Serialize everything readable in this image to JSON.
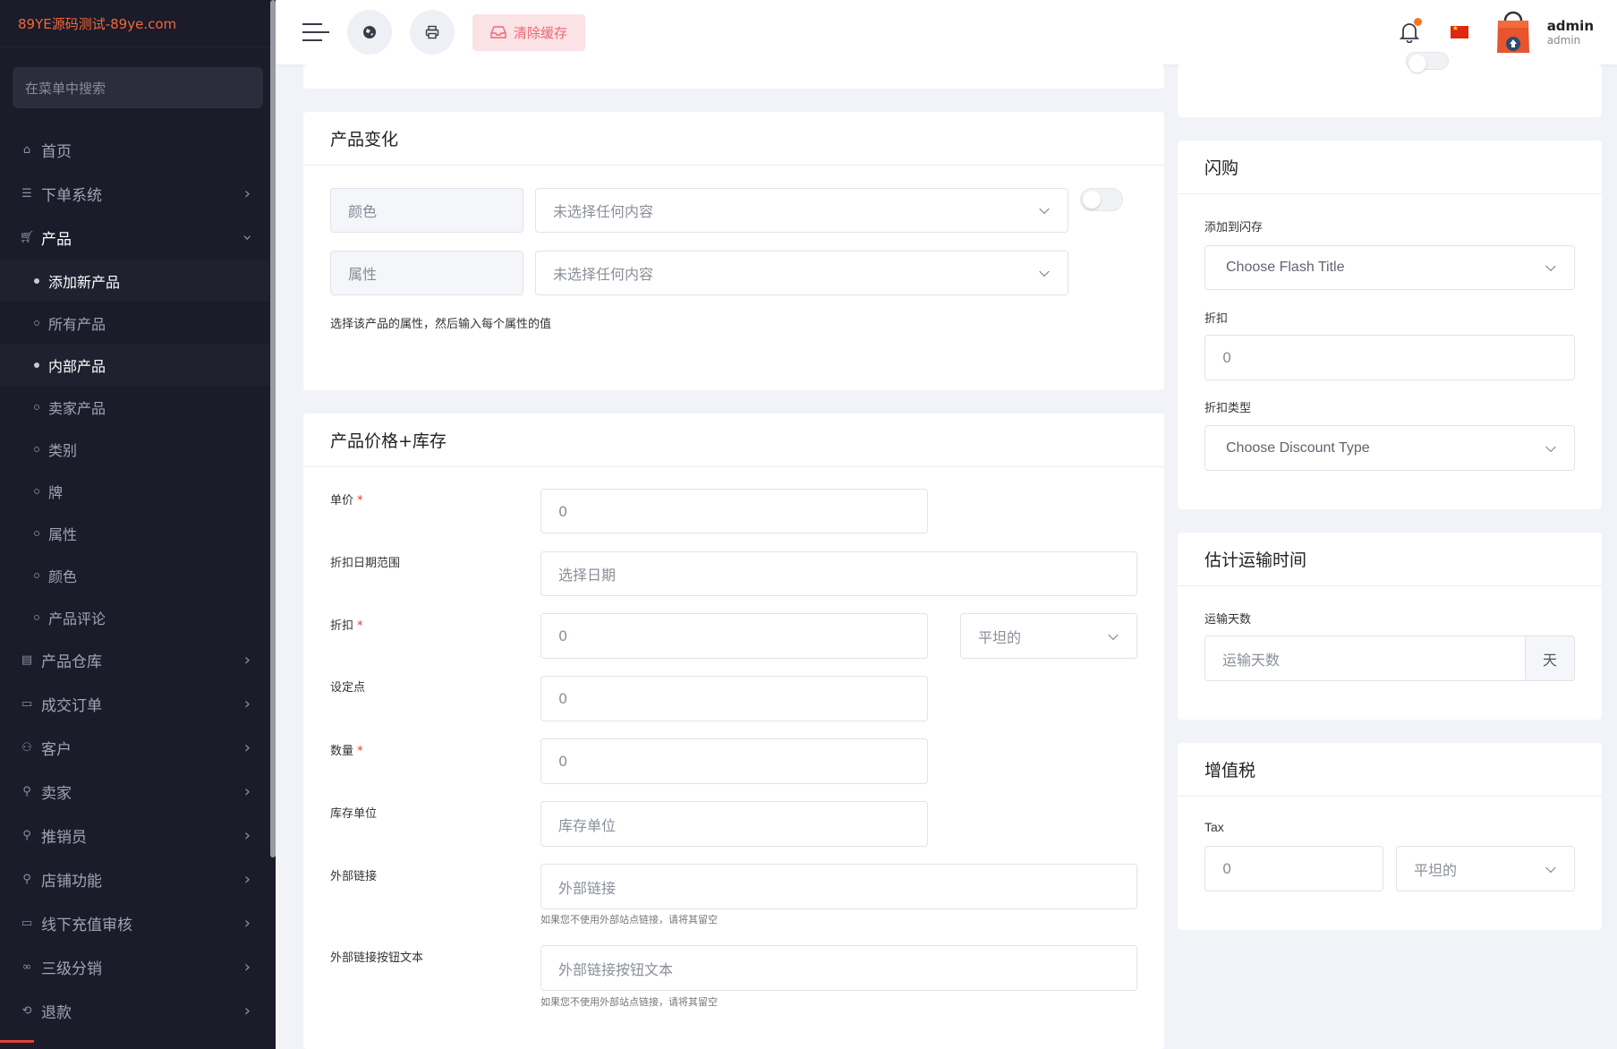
{
  "sidebar": {
    "brand": "89YE源码测试-89ye.com",
    "search_placeholder": "在菜单中搜索",
    "items": [
      {
        "label": "首页",
        "icon": "home-icon"
      },
      {
        "label": "下单系统",
        "icon": "list-icon"
      },
      {
        "label": "产品",
        "icon": "cart-icon"
      }
    ],
    "product_sub": [
      "添加新产品",
      "所有产品",
      "内部产品",
      "卖家产品",
      "类别",
      "牌",
      "属性",
      "颜色",
      "产品评论"
    ],
    "more_items": [
      {
        "label": "产品仓库",
        "icon": "warehouse-icon"
      },
      {
        "label": "成交订单",
        "icon": "money-icon"
      },
      {
        "label": "客户",
        "icon": "users-icon"
      },
      {
        "label": "卖家",
        "icon": "user-icon"
      },
      {
        "label": "推销员",
        "icon": "user-icon"
      },
      {
        "label": "店铺功能",
        "icon": "user-icon"
      },
      {
        "label": "线下充值审核",
        "icon": "money-icon"
      },
      {
        "label": "三级分销",
        "icon": "link-icon"
      },
      {
        "label": "退款",
        "icon": "refund-icon"
      }
    ]
  },
  "header": {
    "clear_cache": "清除缓存",
    "user_name": "admin",
    "user_role": "admin",
    "notification_color": "#f5781f"
  },
  "variation": {
    "title": "产品变化",
    "color_label": "颜色",
    "color_placeholder": "未选择任何内容",
    "attr_label": "属性",
    "attr_placeholder": "未选择任何内容",
    "help": "选择该产品的属性，然后输入每个属性的值"
  },
  "price": {
    "title": "产品价格+库存",
    "unit_price_label": "单价",
    "unit_price_value": "0",
    "date_range_label": "折扣日期范围",
    "date_range_placeholder": "选择日期",
    "discount_label": "折扣",
    "discount_value": "0",
    "discount_type": "平坦的",
    "setpoint_label": "设定点",
    "setpoint_value": "0",
    "quantity_label": "数量",
    "quantity_value": "0",
    "sku_label": "库存单位",
    "sku_placeholder": "库存单位",
    "ext_link_label": "外部链接",
    "ext_link_placeholder": "外部链接",
    "ext_link_help": "如果您不使用外部站点链接，请将其留空",
    "ext_btn_label": "外部链接按钮文本",
    "ext_btn_placeholder": "外部链接按钮文本",
    "ext_btn_help": "如果您不使用外部站点链接，请将其留空"
  },
  "flash": {
    "title": "闪购",
    "add_label": "添加到闪存",
    "add_placeholder": "Choose Flash Title",
    "discount_label": "折扣",
    "discount_value": "0",
    "type_label": "折扣类型",
    "type_placeholder": "Choose Discount Type"
  },
  "shipping": {
    "title": "估计运输时间",
    "days_label": "运输天数",
    "days_placeholder": "运输天数",
    "days_unit": "天"
  },
  "vat": {
    "title": "增值税",
    "tax_label": "Tax",
    "tax_value": "0",
    "tax_type": "平坦的"
  }
}
